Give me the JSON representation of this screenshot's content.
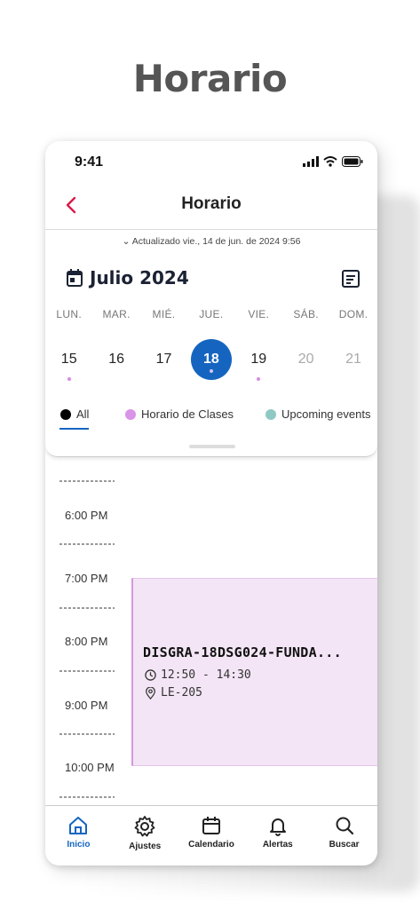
{
  "page_title": "Horario",
  "status": {
    "time": "9:41"
  },
  "header": {
    "title": "Horario"
  },
  "updated_text": "Actualizado vie., 14 de jun. de 2024 9:56",
  "calendar": {
    "month": "Julio 2024",
    "weekdays": [
      "LUN.",
      "MAR.",
      "MIÉ.",
      "JUE.",
      "VIE.",
      "SÁB.",
      "DOM."
    ],
    "days": [
      "15",
      "16",
      "17",
      "18",
      "19",
      "20",
      "21"
    ],
    "selected_day": "18",
    "accent": "#1565c0"
  },
  "filters": [
    {
      "label": "All",
      "color": "#000000"
    },
    {
      "label": "Horario de Clases",
      "color": "#d894e6"
    },
    {
      "label": "Upcoming events",
      "color": "#8fc9c4"
    }
  ],
  "timeline": {
    "hours": [
      "6:00 PM",
      "7:00 PM",
      "8:00 PM",
      "9:00 PM",
      "10:00 PM"
    ]
  },
  "event": {
    "title": "DISGRA-18DSG024-FUNDA...",
    "time": "12:50 - 14:30",
    "location": "LE-205",
    "color": "#f3e5f5"
  },
  "tabs": [
    {
      "label": "Inicio",
      "icon": "home-icon"
    },
    {
      "label": "Ajustes",
      "icon": "gear-icon"
    },
    {
      "label": "Calendario",
      "icon": "calendar-icon"
    },
    {
      "label": "Alertas",
      "icon": "bell-icon"
    },
    {
      "label": "Buscar",
      "icon": "search-icon"
    }
  ]
}
